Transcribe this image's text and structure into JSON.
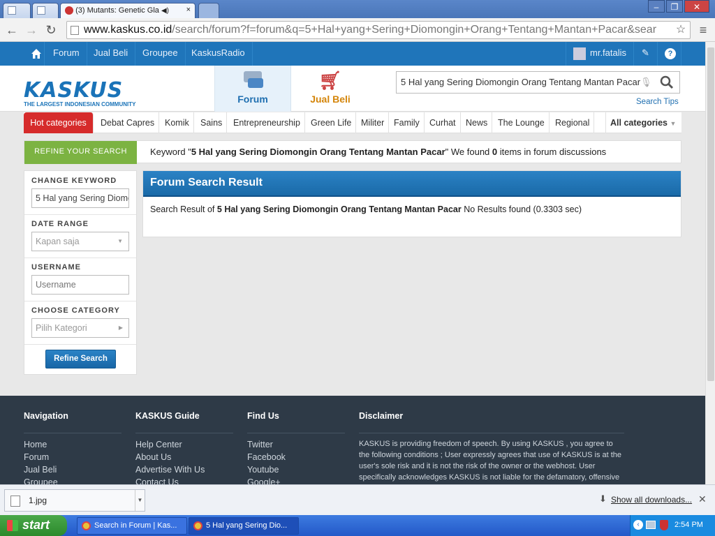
{
  "browser": {
    "tabs": [
      {
        "title": ""
      },
      {
        "title": ""
      },
      {
        "title": "(3) Mutants: Genetic Gla"
      },
      {
        "title": ""
      }
    ],
    "url_host": "www.kaskus.co.id",
    "url_path": "/search/forum?f=forum&q=5+Hal+yang+Sering+Diomongin+Orang+Tentang+Mantan+Pacar&sear"
  },
  "kaskus_nav": {
    "items": [
      "Forum",
      "Jual Beli",
      "Groupee",
      "KaskusRadio"
    ],
    "username": "mr.fatalis"
  },
  "header": {
    "logo_word": "KASKUS",
    "logo_tagline": "THE LARGEST INDONESIAN COMMUNITY",
    "tab_forum": "Forum",
    "tab_jualbeli": "Jual Beli",
    "search_value": "5 Hal yang Sering Diomongin Orang Tentang Mantan Pacar",
    "search_tips": "Search Tips"
  },
  "categories": {
    "hot": "Hot categories",
    "items": [
      "Debat Capres",
      "Komik",
      "Sains",
      "Entrepreneurship",
      "Green Life",
      "Militer",
      "Family",
      "Curhat",
      "News",
      "The Lounge",
      "Regional"
    ],
    "all": "All categories"
  },
  "refine": {
    "label": "REFINE YOUR SEARCH",
    "keyword_prefix": "Keyword \"",
    "keyword": "5 Hal yang Sering Diomongin Orang Tentang Mantan Pacar",
    "found_prefix": "\" We found ",
    "count": "0",
    "found_suffix": " items in forum discussions"
  },
  "sidebar": {
    "change_keyword_label": "CHANGE KEYWORD",
    "keyword_value": "5 Hal yang Sering Diomongin Orang Tentang Mantan Pacar",
    "date_range_label": "DATE RANGE",
    "date_range_value": "Kapan saja",
    "username_label": "USERNAME",
    "username_placeholder": "Username",
    "category_label": "CHOOSE CATEGORY",
    "category_value": "Pilih Kategori",
    "refine_button": "Refine Search"
  },
  "results": {
    "title": "Forum Search Result",
    "prefix": "Search Result of ",
    "query": "5 Hal yang Sering Diomongin Orang Tentang Mantan Pacar",
    "suffix": " No Results found (0.3303 sec)"
  },
  "footer": {
    "navigation_head": "Navigation",
    "navigation": [
      "Home",
      "Forum",
      "Jual Beli",
      "Groupee"
    ],
    "guide_head": "KASKUS Guide",
    "guide": [
      "Help Center",
      "About Us",
      "Advertise With Us",
      "Contact Us"
    ],
    "findus_head": "Find Us",
    "findus": [
      "Twitter",
      "Facebook",
      "Youtube",
      "Google+"
    ],
    "disclaimer_head": "Disclaimer",
    "disclaimer": "KASKUS is providing freedom of speech. By using KASKUS , you agree to the following conditions ; User expressly agrees that use of KASKUS is at the user's sole risk and it is not the risk of the owner or the webhost. User specifically acknowledges KASKUS is not liable for the defamatory, offensive"
  },
  "downloads": {
    "file": "1.jpg",
    "show_all": "Show all downloads..."
  },
  "taskbar": {
    "start": "start",
    "items": [
      "Search in Forum | Kas...",
      "5 Hal yang Sering Dio..."
    ],
    "clock": "2:54 PM"
  },
  "colors": {
    "kaskus_blue": "#1f75ba",
    "refine_green": "#7cb342",
    "hot_red": "#d62b2b",
    "footer_bg": "#2e3a47"
  }
}
